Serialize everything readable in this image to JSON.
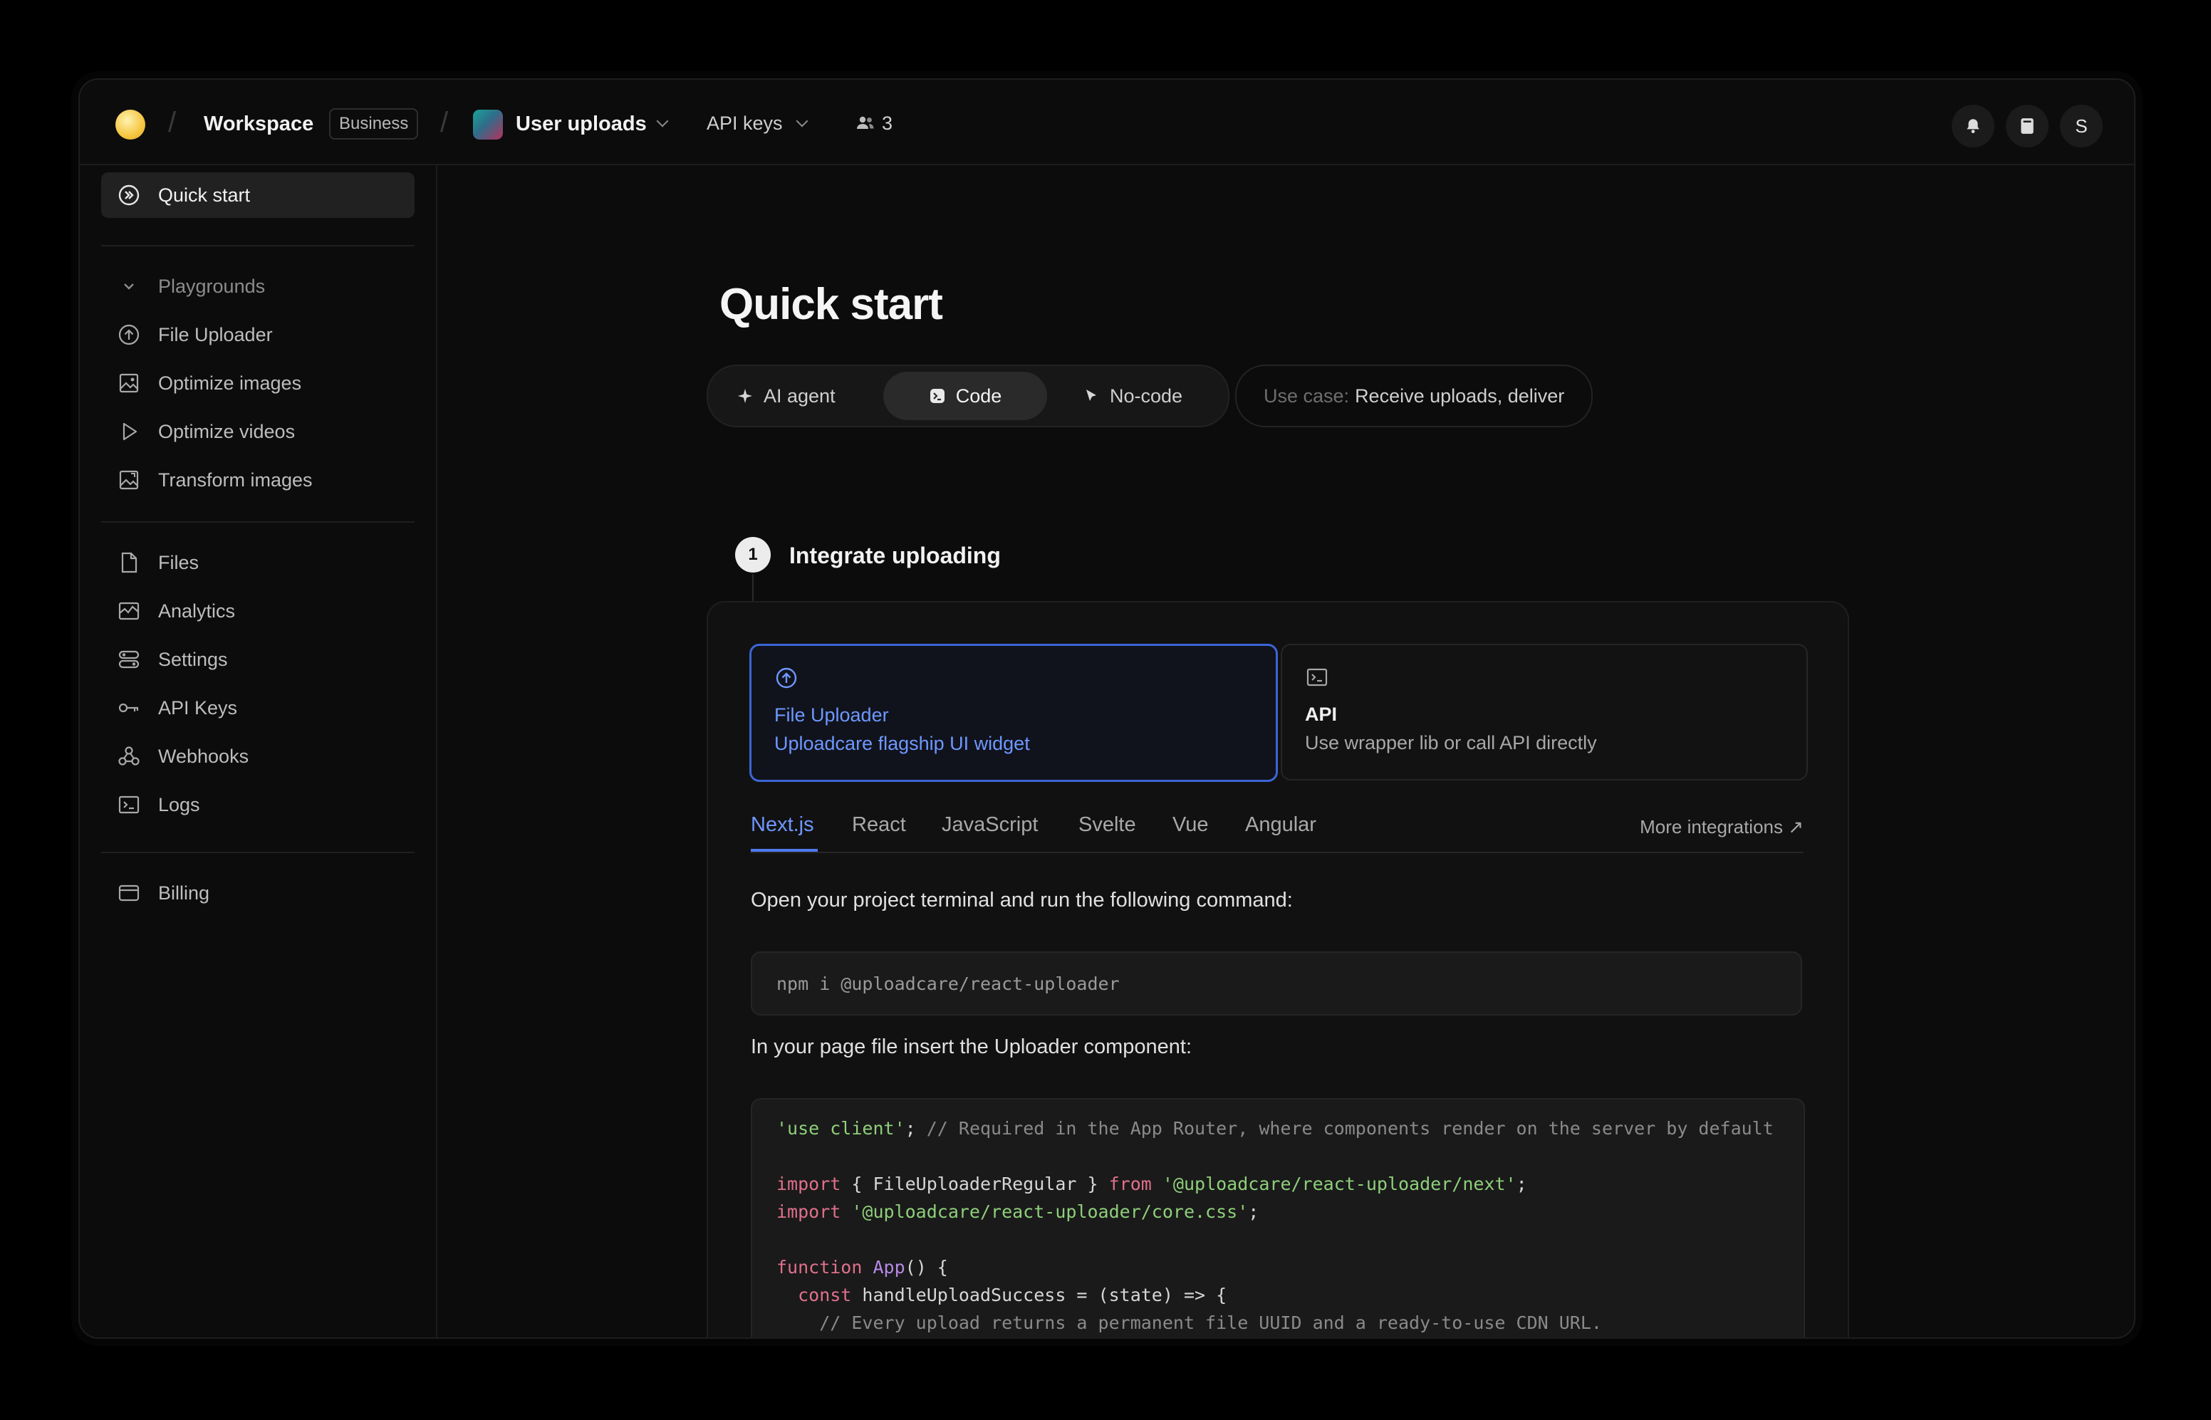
{
  "topbar": {
    "workspace": "Workspace",
    "workspace_badge": "Business",
    "project": "User uploads",
    "api_keys": "API keys",
    "members_count": "3",
    "avatar_initial": "S"
  },
  "sidebar": {
    "quick_start": "Quick start",
    "playgrounds_header": "Playgrounds",
    "playgrounds": [
      "File Uploader",
      "Optimize images",
      "Optimize videos",
      "Transform images"
    ],
    "main_items": [
      "Files",
      "Analytics",
      "Settings",
      "API Keys",
      "Webhooks",
      "Logs"
    ],
    "billing": "Billing"
  },
  "main": {
    "title": "Quick start",
    "modes": [
      "AI agent",
      "Code",
      "No-code"
    ],
    "active_mode": "Code",
    "use_case_label": "Use case:",
    "use_case_value": "Receive uploads, deliver",
    "step": {
      "number": "1",
      "title": "Integrate uploading"
    },
    "options": [
      {
        "title": "File Uploader",
        "desc": "Uploadcare flagship UI widget",
        "icon": "upload-circle-icon",
        "selected": true
      },
      {
        "title": "API",
        "desc": "Use wrapper lib or call API directly",
        "icon": "terminal-icon",
        "selected": false
      }
    ],
    "frameworks": [
      "Next.js",
      "React",
      "JavaScript",
      "Svelte",
      "Vue",
      "Angular"
    ],
    "active_framework": "Next.js",
    "more_integrations": "More integrations ↗",
    "instr_command": "Open your project terminal and run the following command:",
    "command": "npm i @uploadcare/react-uploader",
    "instr_component": "In your page file insert the Uploader component:",
    "code": {
      "l1_str": "'use client'",
      "l1_rest": "; ",
      "l1_comment": "// Required in the App Router, where components render on the server by default",
      "l3_kw": "import",
      "l3_mid": " { FileUploaderRegular } ",
      "l3_from": "from",
      "l3_str": " '@uploadcare/react-uploader/next'",
      "l3_end": ";",
      "l4_kw": "import",
      "l4_str": " '@uploadcare/react-uploader/core.css'",
      "l4_end": ";",
      "l6_kw": "function",
      "l6_fn": " App",
      "l6_end": "() {",
      "l7_kw": "  const",
      "l7_rest": " handleUploadSuccess = (state) => {",
      "l8_comment": "    // Every upload returns a permanent file UUID and a ready-to-use CDN URL."
    }
  },
  "colors": {
    "accent": "#6f97ff",
    "accent_border": "#3c66d6",
    "background": "#0c0c0c"
  }
}
